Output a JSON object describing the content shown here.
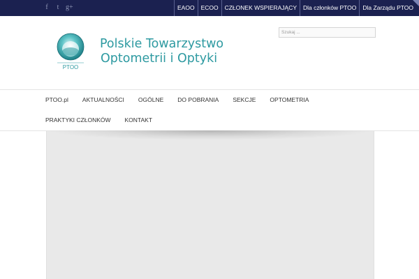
{
  "topbar": {
    "social": [
      {
        "name": "facebook-icon",
        "glyph": "f"
      },
      {
        "name": "twitter-icon",
        "glyph": "t"
      },
      {
        "name": "google-plus-icon",
        "glyph": "g+"
      }
    ],
    "links": [
      "EAOO",
      "ECOO",
      "CZŁONEK WSPIERAJĄCY",
      "Dla członków PTOO",
      "Dla Zarządu PTOO"
    ]
  },
  "header": {
    "logo_text": "PTOO",
    "brand_line1": "Polskie Towarzystwo",
    "brand_line2": "Optometrii i Optyki",
    "search_placeholder": "Szukaj ..."
  },
  "nav": {
    "row1": [
      "PTOO.pl",
      "AKTUALNOŚCI",
      "OGÓLNE",
      "DO POBRANIA",
      "SEKCJE",
      "OPTOMETRIA"
    ],
    "row2": [
      "PRAKTYKI CZŁONKÓW",
      "KONTAKT"
    ]
  },
  "colors": {
    "topbar": "#1b2150",
    "brand": "#2e9aa1",
    "content_bg": "#e9e9e9"
  }
}
